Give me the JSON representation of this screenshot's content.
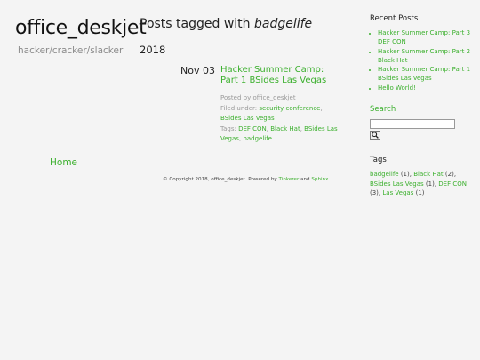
{
  "site": {
    "title": "office_deskjet",
    "tagline": "hacker/cracker/slacker"
  },
  "heading": {
    "prefix": "Posts tagged with ",
    "tag": "badgelife"
  },
  "archive": {
    "year": "2018",
    "post": {
      "date": "Nov 03",
      "title": "Hacker Summer Camp: Part 1 BSides Las Vegas",
      "posted_by_label": "Posted by ",
      "author": "office_deskjet",
      "filed_under_label": "Filed under: ",
      "categories": [
        "security conference",
        "BSides Las Vegas"
      ],
      "tags_label": "Tags: ",
      "tags": [
        "DEF CON",
        "Black Hat",
        "BSides Las Vegas",
        "badgelife"
      ]
    }
  },
  "nav": {
    "home": "Home"
  },
  "footer": {
    "copyright": "© Copyright 2018, office_deskjet. Powered by ",
    "tinkerer": "Tinkerer",
    "and": " and ",
    "sphinx": "Sphinx",
    "end": "."
  },
  "sidebar": {
    "recent_title": "Recent Posts",
    "recent": [
      "Hacker Summer Camp: Part 3 DEF CON",
      "Hacker Summer Camp: Part 2 Black Hat",
      "Hacker Summer Camp: Part 1 BSides Las Vegas",
      "Hello World!"
    ],
    "search_title": "Search",
    "search_value": "",
    "tags_title": "Tags",
    "tags": [
      {
        "name": "badgelife",
        "count": "(1)"
      },
      {
        "name": "Black Hat",
        "count": "(2)"
      },
      {
        "name": "BSides Las Vegas",
        "count": "(1)"
      },
      {
        "name": "DEF CON",
        "count": "(3)"
      },
      {
        "name": "Las Vegas",
        "count": "(1)"
      }
    ]
  },
  "colors": {
    "link": "#3cb02e",
    "background": "#f4f4f4",
    "muted": "#999999"
  }
}
